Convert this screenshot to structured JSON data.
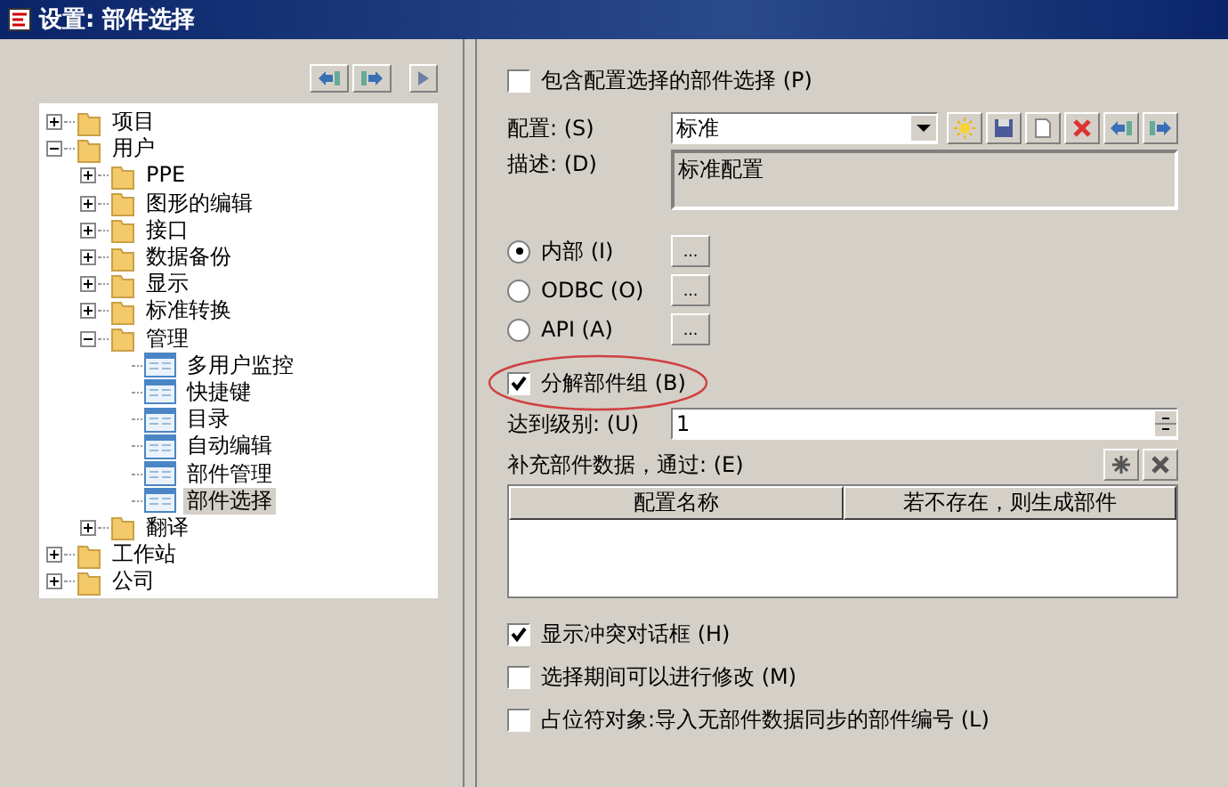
{
  "window": {
    "title": "设置: 部件选择"
  },
  "tree": [
    {
      "label": "项目",
      "kind": "folder",
      "expanded": false,
      "selected": false
    },
    {
      "label": "用户",
      "kind": "folder",
      "expanded": true,
      "selected": false,
      "children": [
        {
          "label": "PPE",
          "kind": "folder",
          "expanded": false,
          "selected": false
        },
        {
          "label": "图形的编辑",
          "kind": "folder",
          "expanded": false,
          "selected": false
        },
        {
          "label": "接口",
          "kind": "folder",
          "expanded": false,
          "selected": false
        },
        {
          "label": "数据备份",
          "kind": "folder",
          "expanded": false,
          "selected": false
        },
        {
          "label": "显示",
          "kind": "folder",
          "expanded": false,
          "selected": false
        },
        {
          "label": "标准转换",
          "kind": "folder",
          "expanded": false,
          "selected": false
        },
        {
          "label": "管理",
          "kind": "folder",
          "expanded": true,
          "selected": false,
          "children": [
            {
              "label": "多用户监控",
              "kind": "page",
              "selected": false
            },
            {
              "label": "快捷键",
              "kind": "page",
              "selected": false
            },
            {
              "label": "目录",
              "kind": "page",
              "selected": false
            },
            {
              "label": "自动编辑",
              "kind": "page",
              "selected": false
            },
            {
              "label": "部件管理",
              "kind": "page",
              "selected": false
            },
            {
              "label": "部件选择",
              "kind": "page",
              "selected": true
            }
          ]
        },
        {
          "label": "翻译",
          "kind": "folder",
          "expanded": false,
          "selected": false
        }
      ]
    },
    {
      "label": "工作站",
      "kind": "folder",
      "expanded": false,
      "selected": false
    },
    {
      "label": "公司",
      "kind": "folder",
      "expanded": false,
      "selected": false
    }
  ],
  "include_checkbox": {
    "label": "包含配置选择的部件选择 (P)",
    "checked": false
  },
  "config": {
    "label": "配置: (S)",
    "value": "标准"
  },
  "description": {
    "label": "描述: (D)",
    "value": "标准配置"
  },
  "sources": [
    {
      "label": "内部 (I)",
      "selected": true,
      "button": "..."
    },
    {
      "label": "ODBC (O)",
      "selected": false,
      "button": "..."
    },
    {
      "label": "API (A)",
      "selected": false,
      "button": "..."
    }
  ],
  "decompose": {
    "label": "分解部件组 (B)",
    "checked": true,
    "highlighted": true
  },
  "level": {
    "label": "达到级别: (U)",
    "value": "1"
  },
  "supplement": {
    "label": "补充部件数据，通过: (E)",
    "columns": [
      "配置名称",
      "若不存在，则生成部件"
    ]
  },
  "bottom_checkboxes": [
    {
      "label": "显示冲突对话框 (H)",
      "checked": true
    },
    {
      "label": "选择期间可以进行修改 (M)",
      "checked": false
    },
    {
      "label": "占位符对象:导入无部件数据同步的部件编号 (L)",
      "checked": false
    }
  ]
}
